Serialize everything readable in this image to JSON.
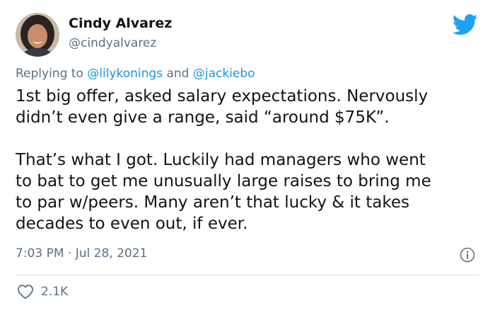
{
  "author": {
    "name": "Cindy Alvarez",
    "handle": "@cindyalvarez"
  },
  "reply": {
    "prefix": "Replying to",
    "mention1": "@lilykonings",
    "conjunction": "and",
    "mention2": "@jackiebo"
  },
  "tweet": {
    "paragraph1": [
      "1st big offer, asked salary expectations. Nervously",
      "didn’t even give a range, said “around $75K”."
    ],
    "paragraph2": [
      "That’s what I got. Luckily had managers who went",
      "to bat to get me unusually large raises to bring me",
      "to par w/peers. Many aren’t that lucky & it takes",
      "decades to even out, if ever."
    ],
    "timestamp": "7:03 PM · Jul 28, 2021"
  },
  "engagement": {
    "likes": "2.1K"
  },
  "icons": {
    "logo": "twitter-bird-icon",
    "info": "info-icon",
    "like": "heart-icon"
  },
  "colors": {
    "accent": "#1da1f2",
    "mention": "#1b95e0",
    "secondary_text": "#5b7083",
    "primary_text": "#0f1419"
  }
}
